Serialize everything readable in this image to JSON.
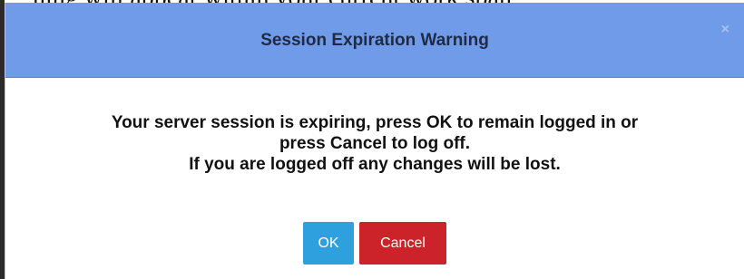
{
  "background": {
    "partial_text": "ning will appear within your current work span,"
  },
  "dialog": {
    "title": "Session Expiration Warning",
    "close_glyph": "×",
    "message_lines": [
      "Your server session is expiring, press OK to remain logged in or",
      "press Cancel to log off.",
      "If you are logged off any changes will be lost."
    ],
    "ok_label": "OK",
    "cancel_label": "Cancel"
  },
  "colors": {
    "titlebar": "#6f9be8",
    "ok_button": "#2ea0de",
    "cancel_button": "#cc2229"
  },
  "icons": {
    "close": "close-icon"
  }
}
